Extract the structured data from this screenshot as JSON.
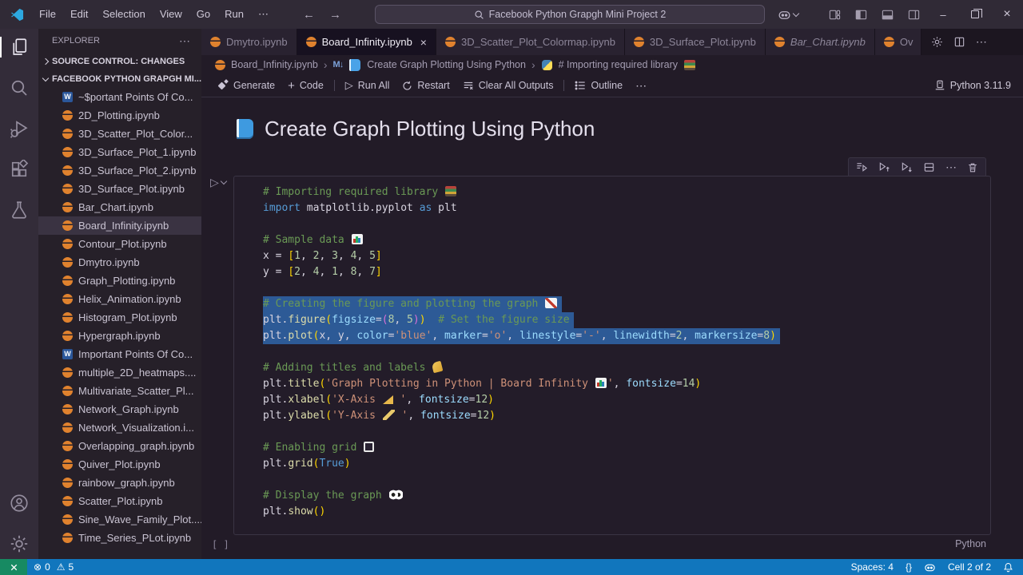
{
  "titlebar": {
    "menus": [
      "File",
      "Edit",
      "Selection",
      "View",
      "Go",
      "Run",
      "⋯"
    ],
    "search_value": "Facebook Python Grapgh Mini Project 2"
  },
  "icons": {
    "more": "⋯",
    "close_tab": "×",
    "minimize": "–",
    "close_window": "×",
    "back": "←",
    "forward": "→",
    "crumb_sep": "›",
    "markdown": "M↓",
    "word_letter": "W",
    "error": "⊗",
    "warning": "⚠",
    "plus": "+",
    "run": "▷"
  },
  "tabs": [
    {
      "label": "Dmytro.ipynb"
    },
    {
      "label": "Board_Infinity.ipynb",
      "active": true,
      "close": true
    },
    {
      "label": "3D_Scatter_Plot_Colormap.ipynb"
    },
    {
      "label": "3D_Surface_Plot.ipynb"
    },
    {
      "label": "Bar_Chart.ipynb",
      "italic": true
    },
    {
      "label": "Ov",
      "partial": true
    }
  ],
  "breadcrumbs": {
    "file": "Board_Infinity.ipynb",
    "section": "Create Graph Plotting Using Python",
    "cell": "# Importing required library"
  },
  "nb_toolbar": {
    "generate": "Generate",
    "code": "Code",
    "run_all": "Run All",
    "restart": "Restart",
    "clear": "Clear All Outputs",
    "outline": "Outline",
    "kernel": "Python 3.11.9"
  },
  "explorer": {
    "title": "EXPLORER",
    "source_control": "SOURCE CONTROL: CHANGES",
    "workspace": "FACEBOOK PYTHON GRAPGH MI...",
    "files": [
      {
        "name": "~$portant Points Of Co...",
        "icon": "word"
      },
      {
        "name": "2D_Plotting.ipynb",
        "icon": "notebook"
      },
      {
        "name": "3D_Scatter_Plot_Color...",
        "icon": "notebook"
      },
      {
        "name": "3D_Surface_Plot_1.ipynb",
        "icon": "notebook"
      },
      {
        "name": "3D_Surface_Plot_2.ipynb",
        "icon": "notebook"
      },
      {
        "name": "3D_Surface_Plot.ipynb",
        "icon": "notebook"
      },
      {
        "name": "Bar_Chart.ipynb",
        "icon": "notebook"
      },
      {
        "name": "Board_Infinity.ipynb",
        "icon": "notebook",
        "selected": true
      },
      {
        "name": "Contour_Plot.ipynb",
        "icon": "notebook"
      },
      {
        "name": "Dmytro.ipynb",
        "icon": "notebook"
      },
      {
        "name": "Graph_Plotting.ipynb",
        "icon": "notebook"
      },
      {
        "name": "Helix_Animation.ipynb",
        "icon": "notebook"
      },
      {
        "name": "Histogram_Plot.ipynb",
        "icon": "notebook"
      },
      {
        "name": "Hypergraph.ipynb",
        "icon": "notebook"
      },
      {
        "name": "Important Points Of Co...",
        "icon": "word"
      },
      {
        "name": "multiple_2D_heatmaps....",
        "icon": "notebook"
      },
      {
        "name": "Multivariate_Scatter_Pl...",
        "icon": "notebook"
      },
      {
        "name": "Network_Graph.ipynb",
        "icon": "notebook"
      },
      {
        "name": "Network_Visualization.i...",
        "icon": "notebook"
      },
      {
        "name": "Overlapping_graph.ipynb",
        "icon": "notebook"
      },
      {
        "name": "Quiver_Plot.ipynb",
        "icon": "notebook"
      },
      {
        "name": "rainbow_graph.ipynb",
        "icon": "notebook"
      },
      {
        "name": "Scatter_Plot.ipynb",
        "icon": "notebook"
      },
      {
        "name": "Sine_Wave_Family_Plot....",
        "icon": "notebook"
      },
      {
        "name": "Time_Series_PLot.ipynb",
        "icon": "notebook"
      }
    ]
  },
  "notebook": {
    "heading": "Create Graph Plotting Using Python",
    "exec_indicator": "[ ]",
    "cell_language": "Python",
    "lines": [
      {
        "tokens": [
          {
            "t": "# Importing required library ",
            "c": "cm"
          },
          {
            "i": "books"
          }
        ]
      },
      {
        "tokens": [
          {
            "t": "import",
            "c": "kw"
          },
          {
            "t": " matplotlib.pyplot ",
            "c": "tx"
          },
          {
            "t": "as",
            "c": "kw"
          },
          {
            "t": " plt",
            "c": "tx"
          }
        ]
      },
      {
        "tokens": []
      },
      {
        "tokens": [
          {
            "t": "# Sample data ",
            "c": "cm"
          },
          {
            "i": "chart"
          }
        ]
      },
      {
        "tokens": [
          {
            "t": "x ",
            "c": "tx"
          },
          {
            "t": "= ",
            "c": "op"
          },
          {
            "t": "[",
            "c": "b1"
          },
          {
            "t": "1",
            "c": "num"
          },
          {
            "t": ", ",
            "c": "tx"
          },
          {
            "t": "2",
            "c": "num"
          },
          {
            "t": ", ",
            "c": "tx"
          },
          {
            "t": "3",
            "c": "num"
          },
          {
            "t": ", ",
            "c": "tx"
          },
          {
            "t": "4",
            "c": "num"
          },
          {
            "t": ", ",
            "c": "tx"
          },
          {
            "t": "5",
            "c": "num"
          },
          {
            "t": "]",
            "c": "b1"
          }
        ]
      },
      {
        "tokens": [
          {
            "t": "y ",
            "c": "tx"
          },
          {
            "t": "= ",
            "c": "op"
          },
          {
            "t": "[",
            "c": "b1"
          },
          {
            "t": "2",
            "c": "num"
          },
          {
            "t": ", ",
            "c": "tx"
          },
          {
            "t": "4",
            "c": "num"
          },
          {
            "t": ", ",
            "c": "tx"
          },
          {
            "t": "1",
            "c": "num"
          },
          {
            "t": ", ",
            "c": "tx"
          },
          {
            "t": "8",
            "c": "num"
          },
          {
            "t": ", ",
            "c": "tx"
          },
          {
            "t": "7",
            "c": "num"
          },
          {
            "t": "]",
            "c": "b1"
          }
        ]
      },
      {
        "tokens": []
      },
      {
        "sel": true,
        "tokens": [
          {
            "t": "# Creating the figure and plotting the graph ",
            "c": "cm"
          },
          {
            "i": "chartup"
          }
        ]
      },
      {
        "sel": true,
        "tokens": [
          {
            "t": "plt.",
            "c": "tx"
          },
          {
            "t": "figure",
            "c": "fn"
          },
          {
            "t": "(",
            "c": "b1"
          },
          {
            "t": "figsize",
            "c": "arg"
          },
          {
            "t": "=",
            "c": "op"
          },
          {
            "t": "(",
            "c": "b2"
          },
          {
            "t": "8",
            "c": "num"
          },
          {
            "t": ", ",
            "c": "tx"
          },
          {
            "t": "5",
            "c": "num"
          },
          {
            "t": ")",
            "c": "b2"
          },
          {
            "t": ")",
            "c": "b1"
          },
          {
            "t": "  ",
            "c": "tx"
          },
          {
            "t": "# Set the figure size",
            "c": "cm"
          }
        ]
      },
      {
        "sel": true,
        "tokens": [
          {
            "t": "plt.",
            "c": "tx"
          },
          {
            "t": "plot",
            "c": "fn"
          },
          {
            "t": "(",
            "c": "b1"
          },
          {
            "t": "x, y, ",
            "c": "tx"
          },
          {
            "t": "color",
            "c": "arg"
          },
          {
            "t": "=",
            "c": "op"
          },
          {
            "t": "'blue'",
            "c": "str"
          },
          {
            "t": ", ",
            "c": "tx"
          },
          {
            "t": "marker",
            "c": "arg"
          },
          {
            "t": "=",
            "c": "op"
          },
          {
            "t": "'o'",
            "c": "str"
          },
          {
            "t": ", ",
            "c": "tx"
          },
          {
            "t": "linestyle",
            "c": "arg"
          },
          {
            "t": "=",
            "c": "op"
          },
          {
            "t": "'-'",
            "c": "str"
          },
          {
            "t": ", ",
            "c": "tx"
          },
          {
            "t": "linewidth",
            "c": "arg"
          },
          {
            "t": "=",
            "c": "op"
          },
          {
            "t": "2",
            "c": "num"
          },
          {
            "t": ", ",
            "c": "tx"
          },
          {
            "t": "markersize",
            "c": "arg"
          },
          {
            "t": "=",
            "c": "op"
          },
          {
            "t": "8",
            "c": "num"
          },
          {
            "t": ")",
            "c": "b1"
          }
        ]
      },
      {
        "tokens": []
      },
      {
        "tokens": [
          {
            "t": "# Adding titles and labels ",
            "c": "cm"
          },
          {
            "i": "label"
          }
        ]
      },
      {
        "tokens": [
          {
            "t": "plt.",
            "c": "tx"
          },
          {
            "t": "title",
            "c": "fn"
          },
          {
            "t": "(",
            "c": "b1"
          },
          {
            "t": "'Graph Plotting in Python | Board Infinity ",
            "c": "str"
          },
          {
            "i": "chart"
          },
          {
            "t": "'",
            "c": "str"
          },
          {
            "t": ", ",
            "c": "tx"
          },
          {
            "t": "fontsize",
            "c": "arg"
          },
          {
            "t": "=",
            "c": "op"
          },
          {
            "t": "14",
            "c": "num"
          },
          {
            "t": ")",
            "c": "b1"
          }
        ]
      },
      {
        "tokens": [
          {
            "t": "plt.",
            "c": "tx"
          },
          {
            "t": "xlabel",
            "c": "fn"
          },
          {
            "t": "(",
            "c": "b1"
          },
          {
            "t": "'X-Axis ",
            "c": "str"
          },
          {
            "i": "triruler"
          },
          {
            "t": " '",
            "c": "str"
          },
          {
            "t": ", ",
            "c": "tx"
          },
          {
            "t": "fontsize",
            "c": "arg"
          },
          {
            "t": "=",
            "c": "op"
          },
          {
            "t": "12",
            "c": "num"
          },
          {
            "t": ")",
            "c": "b1"
          }
        ]
      },
      {
        "tokens": [
          {
            "t": "plt.",
            "c": "tx"
          },
          {
            "t": "ylabel",
            "c": "fn"
          },
          {
            "t": "(",
            "c": "b1"
          },
          {
            "t": "'Y-Axis ",
            "c": "str"
          },
          {
            "i": "ruler"
          },
          {
            "t": " '",
            "c": "str"
          },
          {
            "t": ", ",
            "c": "tx"
          },
          {
            "t": "fontsize",
            "c": "arg"
          },
          {
            "t": "=",
            "c": "op"
          },
          {
            "t": "12",
            "c": "num"
          },
          {
            "t": ")",
            "c": "b1"
          }
        ]
      },
      {
        "tokens": []
      },
      {
        "tokens": [
          {
            "t": "# Enabling grid ",
            "c": "cm"
          },
          {
            "i": "square"
          }
        ]
      },
      {
        "tokens": [
          {
            "t": "plt.",
            "c": "tx"
          },
          {
            "t": "grid",
            "c": "fn"
          },
          {
            "t": "(",
            "c": "b1"
          },
          {
            "t": "True",
            "c": "kw"
          },
          {
            "t": ")",
            "c": "b1"
          }
        ]
      },
      {
        "tokens": []
      },
      {
        "tokens": [
          {
            "t": "# Display the graph ",
            "c": "cm"
          },
          {
            "i": "eyes"
          }
        ]
      },
      {
        "tokens": [
          {
            "t": "plt.",
            "c": "tx"
          },
          {
            "t": "show",
            "c": "fn"
          },
          {
            "t": "(",
            "c": "b1"
          },
          {
            "t": ")",
            "c": "b1"
          }
        ]
      }
    ]
  },
  "statusbar": {
    "errors": "0",
    "warnings": "5",
    "spaces": "Spaces: 4",
    "braces": "{}",
    "cell": "Cell 2 of 2"
  }
}
